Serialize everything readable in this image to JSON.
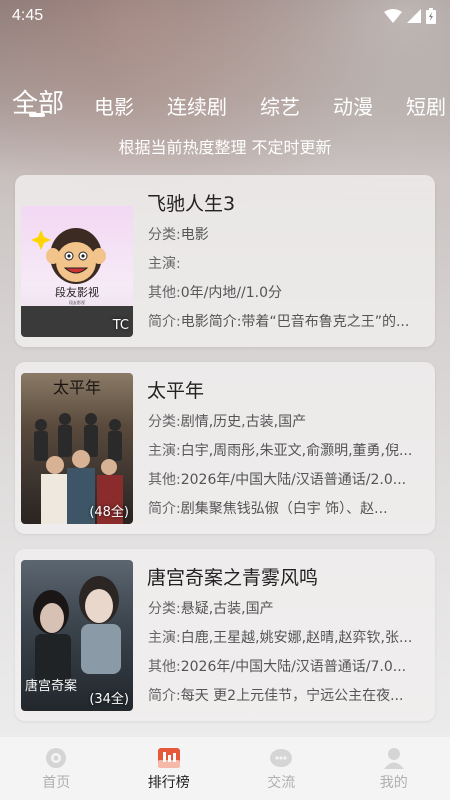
{
  "status_bar": {
    "time": "4:45"
  },
  "tabs": [
    {
      "label": "全部",
      "active": true
    },
    {
      "label": "电影"
    },
    {
      "label": "连续剧"
    },
    {
      "label": "综艺"
    },
    {
      "label": "动漫"
    },
    {
      "label": "短剧"
    }
  ],
  "subtitle": "根据当前热度整理 不定时更新",
  "cards": [
    {
      "title": "飞驰人生3",
      "badge": "TC",
      "poster_brand": "段友影视",
      "poster_sub": "段友影视",
      "category_key": "分类:",
      "category": "电影",
      "cast_key": "主演:",
      "cast": "",
      "other_key": "其他:",
      "other": "0年/内地//1.0分",
      "intro_key": "简介:",
      "intro": "电影简介:带着“巴音布鲁克之王”的..."
    },
    {
      "title": "太平年",
      "badge": "(48全)",
      "poster_brand": "太平年",
      "category_key": "分类:",
      "category": "剧情,历史,古装,国产",
      "cast_key": "主演:",
      "cast": "白宇,周雨彤,朱亚文,俞灏明,董勇,倪...",
      "other_key": "其他:",
      "other": "2026年/中国大陆/汉语普通话/2.0...",
      "intro_key": "简介:",
      "intro": "剧集聚焦钱弘俶（白宇 饰）、赵..."
    },
    {
      "title": "唐宫奇案之青雾风鸣",
      "badge": "(34全)",
      "poster_brand": "唐宫奇案",
      "category_key": "分类:",
      "category": "悬疑,古装,国产",
      "cast_key": "主演:",
      "cast": "白鹿,王星越,姚安娜,赵晴,赵弈钦,张...",
      "other_key": "其他:",
      "other": "2026年/中国大陆/汉语普通话/7.0...",
      "intro_key": "简介:",
      "intro": "每天 更2上元佳节，宁远公主在夜..."
    }
  ],
  "bottom_nav": [
    {
      "label": "首页",
      "icon": "home-icon"
    },
    {
      "label": "排行榜",
      "icon": "ranking-icon",
      "active": true
    },
    {
      "label": "交流",
      "icon": "chat-icon"
    },
    {
      "label": "我的",
      "icon": "profile-icon"
    }
  ]
}
